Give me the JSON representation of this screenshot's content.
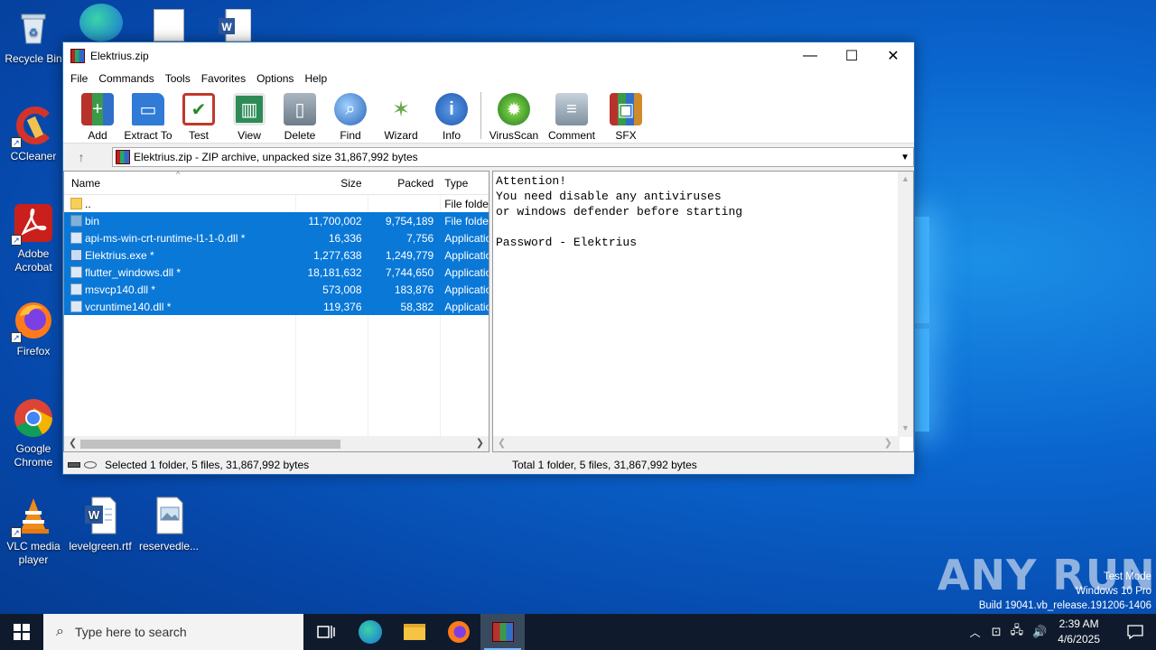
{
  "desktop": {
    "icons": [
      {
        "label": "Recycle Bin"
      },
      {
        "label": "CCleaner"
      },
      {
        "label": "Adobe Acrobat"
      },
      {
        "label": "Firefox"
      },
      {
        "label": "Google Chrome"
      },
      {
        "label": "VLC media player"
      },
      {
        "label": "levelgreen.rtf"
      },
      {
        "label": "reservedle..."
      }
    ],
    "watermark": {
      "line1": "Test Mode",
      "line2": "Windows 10 Pro",
      "line3": "Build 19041.vb_release.191206-1406",
      "brand": "ANY RUN"
    }
  },
  "window": {
    "title": "Elektrius.zip",
    "controls": {
      "minimize": "—",
      "maximize": "☐",
      "close": "✕"
    },
    "menu": [
      "File",
      "Commands",
      "Tools",
      "Favorites",
      "Options",
      "Help"
    ],
    "toolbar": [
      {
        "label": "Add",
        "icon": "add-archive-icon",
        "color": "#b8322d"
      },
      {
        "label": "Extract To",
        "icon": "extract-folder-icon",
        "color": "#2f7bd6"
      },
      {
        "label": "Test",
        "icon": "test-clipboard-icon",
        "color": "#c0392b"
      },
      {
        "label": "View",
        "icon": "view-book-icon",
        "color": "#2e8b57"
      },
      {
        "label": "Delete",
        "icon": "delete-trash-icon",
        "color": "#8a9aa8"
      },
      {
        "label": "Find",
        "icon": "find-magnifier-icon",
        "color": "#2a64b8"
      },
      {
        "label": "Wizard",
        "icon": "wizard-wand-icon",
        "color": "#6aa84f"
      },
      {
        "label": "Info",
        "icon": "info-icon",
        "color": "#2f6fc9"
      },
      {
        "label": "VirusScan",
        "icon": "virusscan-bug-icon",
        "color": "#2d8a2d"
      },
      {
        "label": "Comment",
        "icon": "comment-icon",
        "color": "#8c9aa6"
      },
      {
        "label": "SFX",
        "icon": "sfx-archive-icon",
        "color": "#d08a28"
      }
    ],
    "address": "Elektrius.zip - ZIP archive, unpacked size 31,867,992 bytes",
    "columns": {
      "name": "Name",
      "size": "Size",
      "packed": "Packed",
      "type": "Type"
    },
    "files": [
      {
        "name": "..",
        "size": "",
        "packed": "",
        "type": "File folder",
        "kind": "folder",
        "selected": false
      },
      {
        "name": "bin",
        "size": "11,700,002",
        "packed": "9,754,189",
        "type": "File folder",
        "kind": "folder",
        "selected": true
      },
      {
        "name": "api-ms-win-crt-runtime-l1-1-0.dll *",
        "size": "16,336",
        "packed": "7,756",
        "type": "Application",
        "kind": "dll",
        "selected": true
      },
      {
        "name": "Elektrius.exe *",
        "size": "1,277,638",
        "packed": "1,249,779",
        "type": "Application",
        "kind": "exe",
        "selected": true
      },
      {
        "name": "flutter_windows.dll *",
        "size": "18,181,632",
        "packed": "7,744,650",
        "type": "Application",
        "kind": "dll",
        "selected": true
      },
      {
        "name": "msvcp140.dll *",
        "size": "573,008",
        "packed": "183,876",
        "type": "Application",
        "kind": "dll",
        "selected": true
      },
      {
        "name": "vcruntime140.dll *",
        "size": "119,376",
        "packed": "58,382",
        "type": "Application",
        "kind": "dll",
        "selected": true
      }
    ],
    "comment": "Attention!\nYou need disable any antiviruses\nor windows defender before starting\n\nPassword - Elektrius",
    "status_left": "Selected 1 folder, 5 files, 31,867,992 bytes",
    "status_right": "Total 1 folder, 5 files, 31,867,992 bytes"
  },
  "taskbar": {
    "search_placeholder": "Type here to search",
    "time": "2:39 AM",
    "date": "4/6/2025"
  }
}
